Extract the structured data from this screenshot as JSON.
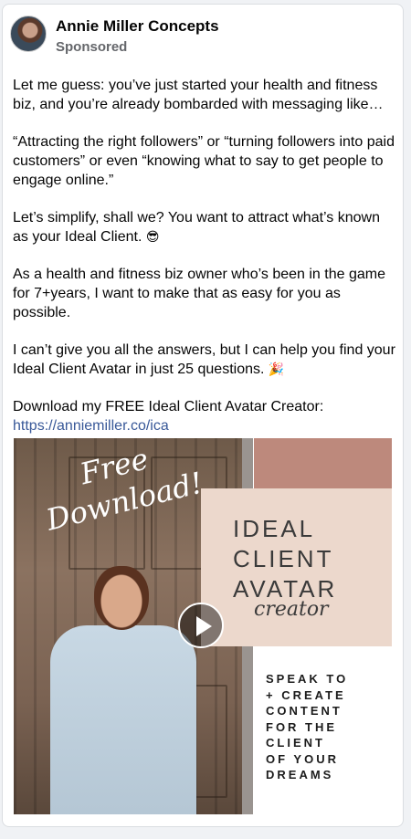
{
  "post": {
    "author": "Annie Miller Concepts",
    "sponsored_label": "Sponsored",
    "paragraphs": [
      "Let me guess: you’ve just started your health and fitness biz, and you’re already bombarded with messaging like…",
      "“Attracting the right followers” or “turning followers into paid customers” or even “knowing what to say to get people to engage online.”",
      "Let’s simplify, shall we? You want to attract what’s known as your Ideal Client.",
      "As a health and fitness biz owner who’s been in the game for 7+years, I want to make that as easy for you as possible.",
      "I can’t give you all the answers, but I can help you find your Ideal Client Avatar in just 25 questions."
    ],
    "emoji_cool": "😎",
    "emoji_party": "🎉",
    "download_text": "Download my FREE Ideal Client Avatar Creator:",
    "link": "https://anniemiller.co/ica"
  },
  "media": {
    "script_line1": "Free",
    "script_line2": "Download!",
    "title_line1": "IDEAL",
    "title_line2": "CLIENT",
    "title_line3": "AVATAR",
    "title_script": "creator",
    "tagline_lines": [
      "SPEAK TO",
      "+ CREATE",
      "CONTENT",
      "FOR THE",
      "CLIENT",
      "OF YOUR",
      "DREAMS"
    ],
    "colors": {
      "brown": "#bd897c",
      "pink": "#ecd8cc"
    }
  }
}
